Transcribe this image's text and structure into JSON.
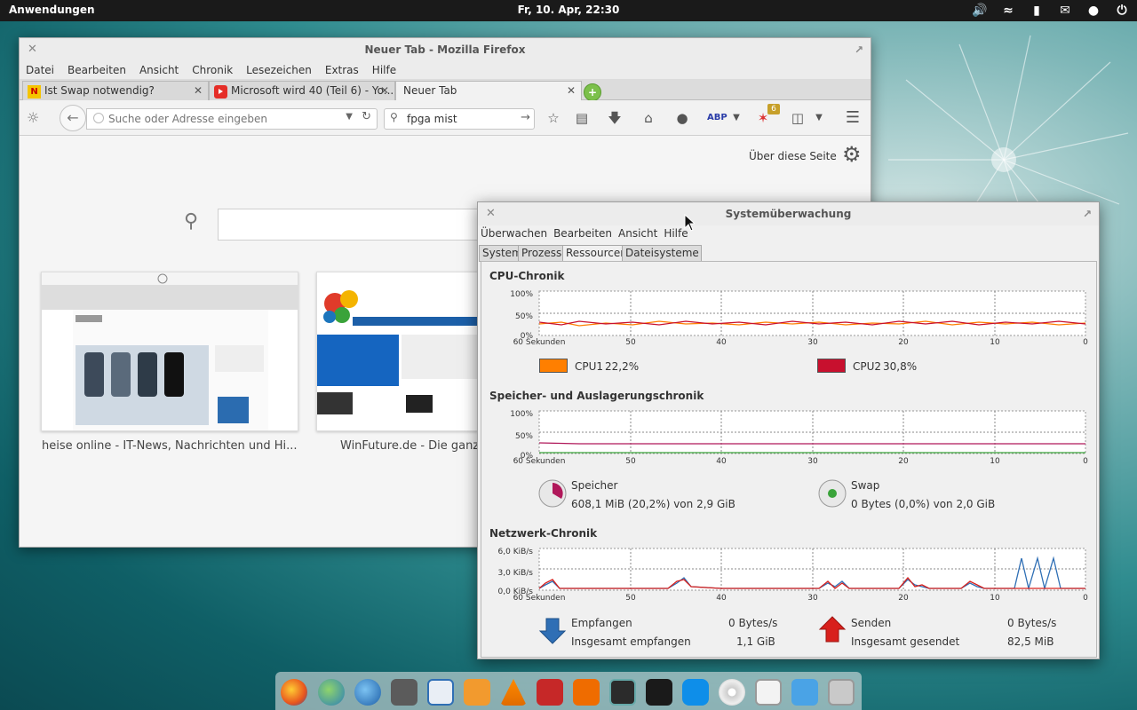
{
  "panel": {
    "apps_label": "Anwendungen",
    "clock": "Fr, 10. Apr, 22:30"
  },
  "firefox": {
    "title": "Neuer Tab - Mozilla Firefox",
    "menu": [
      "Datei",
      "Bearbeiten",
      "Ansicht",
      "Chronik",
      "Lesezeichen",
      "Extras",
      "Hilfe"
    ],
    "tabs": [
      {
        "label": "Ist Swap notwendig?",
        "favicon": "N"
      },
      {
        "label": "Microsoft wird 40 (Teil 6) - Yo...",
        "favicon": "youtube-icon"
      },
      {
        "label": "Neuer Tab",
        "favicon": ""
      }
    ],
    "url_placeholder": "Suche oder Adresse eingeben",
    "search_value": "fpga mist",
    "abp_badge": "6",
    "about_link": "Über diese Seite",
    "thumbnails": [
      {
        "label": "heise online - IT-News, Nachrichten und Hi..."
      },
      {
        "label": "WinFuture.de - Die ganz"
      }
    ]
  },
  "sysmon": {
    "title": "Systemüberwachung",
    "menu": [
      "Überwachen",
      "Bearbeiten",
      "Ansicht",
      "Hilfe"
    ],
    "tabs": [
      "System",
      "Prozesse",
      "Ressourcen",
      "Dateisysteme"
    ],
    "active_tab": "Ressourcen",
    "x_ticks": [
      "60 Sekunden",
      "50",
      "40",
      "30",
      "20",
      "10",
      "0"
    ],
    "cpu": {
      "title": "CPU-Chronik",
      "y_ticks": [
        "100%",
        "50%",
        "0%"
      ],
      "cpu1_label": "CPU1",
      "cpu1_value": "22,2%",
      "cpu1_color": "#ff7f00",
      "cpu2_label": "CPU2",
      "cpu2_value": "30,8%",
      "cpu2_color": "#c8102e"
    },
    "memory": {
      "title": "Speicher- und Auslagerungschronik",
      "y_ticks": [
        "100%",
        "50%",
        "0%"
      ],
      "mem_label": "Speicher",
      "mem_value": "608,1 MiB (20,2%) von 2,9 GiB",
      "mem_color": "#b0185a",
      "swap_label": "Swap",
      "swap_value": "0 Bytes (0,0%) von 2,0 GiB",
      "swap_color": "#3aa33a"
    },
    "network": {
      "title": "Netzwerk-Chronik",
      "y_ticks": [
        "6,0 KiB/s",
        "3,0 KiB/s",
        "0,0 KiB/s"
      ],
      "recv_label": "Empfangen",
      "recv_rate": "0 Bytes/s",
      "recv_total_label": "Insgesamt empfangen",
      "recv_total": "1,1 GiB",
      "recv_color": "#2f6fb5",
      "sent_label": "Senden",
      "sent_rate": "0 Bytes/s",
      "sent_total_label": "Insgesamt gesendet",
      "sent_total": "82,5 MiB",
      "sent_color": "#d8201c"
    }
  },
  "dock": {
    "items": [
      "firefox-icon",
      "globe-icon",
      "google-earth-icon",
      "calculator-icon",
      "document-icon",
      "music-icon",
      "vlc-icon",
      "video-icon",
      "photo-icon",
      "system-monitor-icon",
      "terminal-icon",
      "teamviewer-icon",
      "disc-icon",
      "file-manager-icon",
      "download-icon",
      "folder-icon"
    ]
  }
}
